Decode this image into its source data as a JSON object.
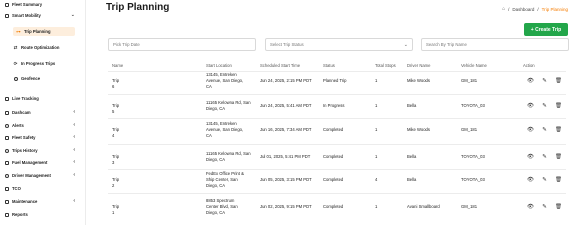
{
  "sidebar": {
    "items": [
      {
        "label": "Fleet Summary",
        "icon": "dashboard-icon",
        "chevron": false
      },
      {
        "label": "Smart Mobility",
        "icon": "mobility-icon",
        "chevron": true
      },
      {
        "label": "Trip Planning",
        "icon": "trip-icon",
        "chevron": false,
        "active": true
      },
      {
        "label": "Route Optimization",
        "icon": "route-icon",
        "chevron": false
      },
      {
        "label": "In Progress Trips",
        "icon": "progress-icon",
        "chevron": false
      },
      {
        "label": "Geofence",
        "icon": "geofence-icon",
        "chevron": false
      },
      {
        "label": "Live Tracking",
        "icon": "tracking-icon",
        "chevron": false
      },
      {
        "label": "Dashcam",
        "icon": "camera-icon",
        "chevron": true
      },
      {
        "label": "Alerts",
        "icon": "bell-icon",
        "chevron": true
      },
      {
        "label": "Fleet Safety",
        "icon": "shield-icon",
        "chevron": true
      },
      {
        "label": "Trips History",
        "icon": "history-icon",
        "chevron": true
      },
      {
        "label": "Fuel Management",
        "icon": "fuel-icon",
        "chevron": true
      },
      {
        "label": "Driver Management",
        "icon": "driver-icon",
        "chevron": true
      },
      {
        "label": "TCO",
        "icon": "tco-icon",
        "chevron": false
      },
      {
        "label": "Maintenance",
        "icon": "wrench-icon",
        "chevron": true
      },
      {
        "label": "Reports",
        "icon": "report-icon",
        "chevron": false
      }
    ]
  },
  "header": {
    "title": "Trip Planning",
    "breadcrumb": [
      "Dashboard",
      "Trip Planning"
    ]
  },
  "filters": {
    "date_placeholder": "Pick Trip Date",
    "status_placeholder": "Select Trip Status",
    "search_placeholder": "Search By Trip Name"
  },
  "create_button": "+ Create Trip",
  "table": {
    "columns": [
      "Name",
      "Start Location",
      "Scheduled Start Time",
      "Status",
      "Total Stops",
      "Driver Name",
      "Vehicle Name",
      "Action"
    ],
    "rows": [
      {
        "name": "Trip 6",
        "location": [
          "13145, Entreken",
          "Avenue, San Diego,",
          "CA"
        ],
        "time": "Jun 24, 2025, 2:15 PM PDT",
        "status": "Planned Trip",
        "stops": "1",
        "driver": "Mike Woods",
        "vehicle": "GM_181"
      },
      {
        "name": "Trip 5",
        "location": [
          "11165 Kelowna Rd, San",
          "Diego, CA"
        ],
        "time": "Jun 24, 2025, 5:41 AM PDT",
        "status": "In Progress",
        "stops": "1",
        "driver": "Bella",
        "vehicle": "TOYOTA_03"
      },
      {
        "name": "Trip 4",
        "location": [
          "13145, Entreken",
          "Avenue, San Diego,",
          "CA"
        ],
        "time": "Jun 16, 2025, 7:34 AM PDT",
        "status": "Completed",
        "stops": "1",
        "driver": "Mike Woods",
        "vehicle": "GM_181"
      },
      {
        "name": "Trip 3",
        "location": [
          "11165 Kelowna Rd, San",
          "Diego, CA"
        ],
        "time": "Jul 01, 2025, 5:41 PM PDT",
        "status": "Completed",
        "stops": "1",
        "driver": "Bella",
        "vehicle": "TOYOTA_03"
      },
      {
        "name": "Trip 2",
        "location": [
          "FedEx Office Print &",
          "Ship Center, San",
          "Diego, CA"
        ],
        "time": "Jun 05, 2025, 3:15 PM PDT",
        "status": "Completed",
        "stops": "4",
        "driver": "Bella",
        "vehicle": "TOYOTA_03"
      },
      {
        "name": "Trip 1",
        "location": [
          "8853 Spectrum",
          "Center Blvd, San",
          "Diego, CA"
        ],
        "time": "Jun 02, 2025, 9:15 PM PDT",
        "status": "Completed",
        "stops": "1",
        "driver": "Avani Smallboard",
        "vehicle": "GM_181"
      }
    ]
  },
  "colors": {
    "accent": "#f57c00",
    "create": "#23a64a",
    "active_bg": "#fdeedd"
  }
}
